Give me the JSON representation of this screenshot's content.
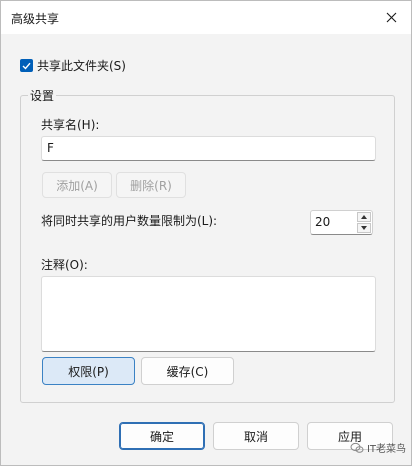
{
  "window": {
    "title": "高级共享",
    "close_icon": "close-icon"
  },
  "share_checkbox": {
    "label": "共享此文件夹(S)",
    "checked": true
  },
  "settings_group": {
    "legend": "设置",
    "share_name_label": "共享名(H):",
    "share_name_value": "F",
    "add_button": "添加(A)",
    "remove_button": "删除(R)",
    "user_limit_label": "将同时共享的用户数量限制为(L):",
    "user_limit_value": "20",
    "comment_label": "注释(O):",
    "comment_value": "",
    "permissions_button": "权限(P)",
    "caching_button": "缓存(C)"
  },
  "footer": {
    "ok_button": "确定",
    "cancel_button": "取消",
    "apply_button": "应用"
  },
  "watermark": {
    "text": "IT老菜鸟"
  },
  "colors": {
    "accent": "#005fb8",
    "focus_fill": "#dce9f7",
    "dialog_bg": "#f3f3f3"
  }
}
